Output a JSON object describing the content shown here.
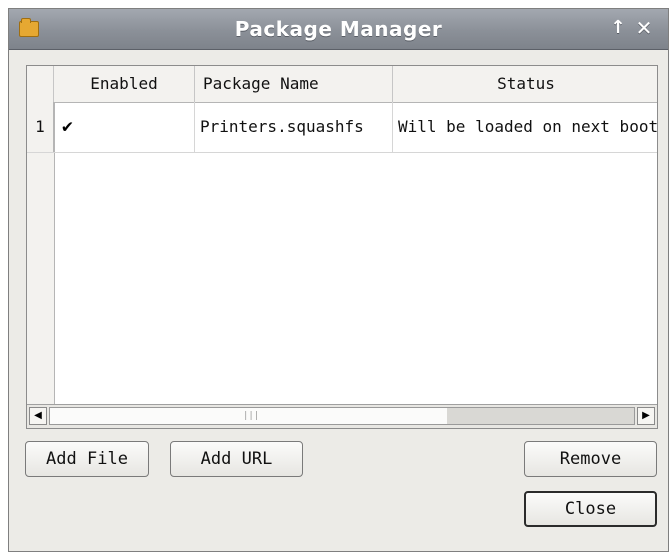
{
  "window": {
    "title": "Package Manager",
    "up_symbol": "↑",
    "close_symbol": "✕",
    "app_icon": "folder-icon"
  },
  "table": {
    "columns": [
      "Enabled",
      "Package Name",
      "Status"
    ],
    "rows": [
      {
        "row_number": "1",
        "enabled": true,
        "enabled_mark": "✔",
        "package_name": "Printers.squashfs",
        "status": "Will be loaded on next boot"
      }
    ],
    "scrollbar": {
      "left_arrow": "◀",
      "right_arrow": "▶",
      "grip": "|||",
      "position_fraction": 0.0,
      "visible_fraction": 0.68
    }
  },
  "buttons": {
    "add_file": "Add File",
    "add_url": "Add URL",
    "remove": "Remove",
    "close": "Close"
  }
}
